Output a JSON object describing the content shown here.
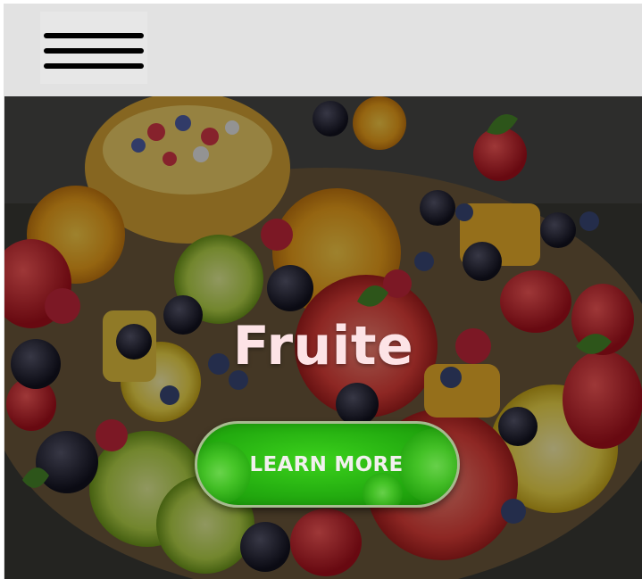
{
  "header": {
    "menu_icon": "hamburger-menu-icon"
  },
  "hero": {
    "title": "Fruite",
    "button_label": "LEARN MORE",
    "background_image": "fruit-platter-photo"
  },
  "colors": {
    "header_background": "#e2e2e2",
    "title_text": "#fde3e6",
    "button_green": "#24ad10",
    "button_text": "#f2f0ee"
  }
}
